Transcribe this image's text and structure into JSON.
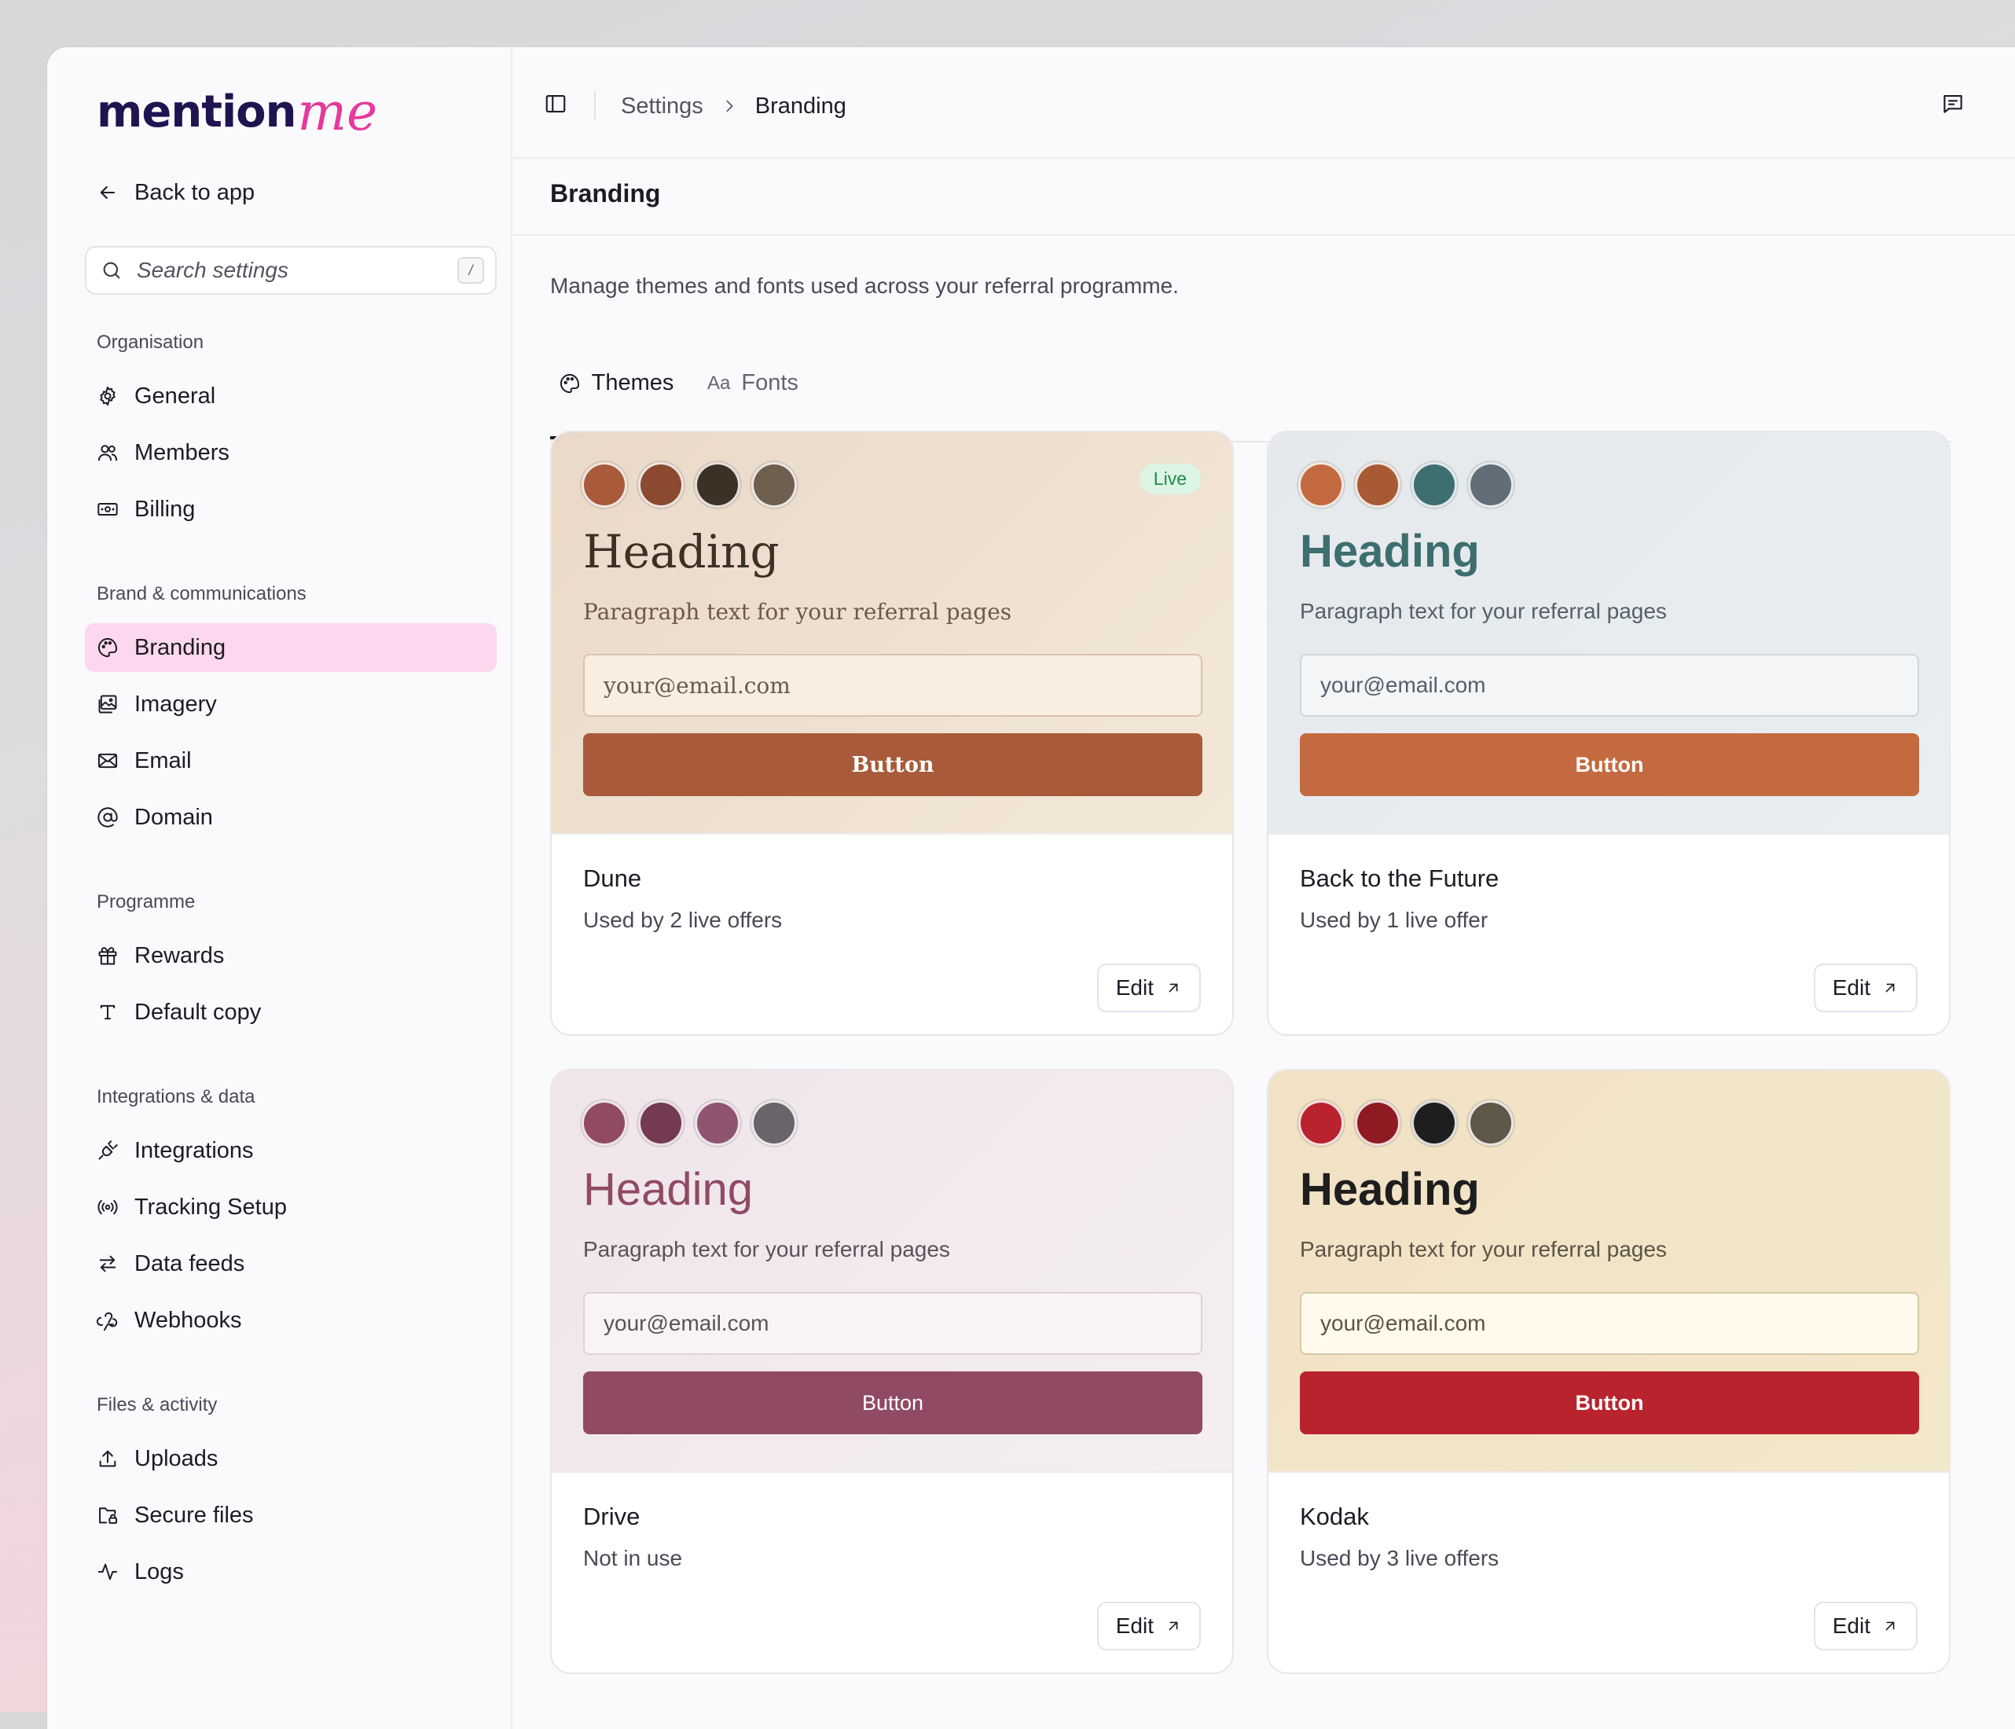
{
  "logo": {
    "main": "mention",
    "accent": "me"
  },
  "sidebar": {
    "back_label": "Back to app",
    "search": {
      "placeholder": "Search settings",
      "shortcut": "/"
    },
    "sections": [
      {
        "title": "Organisation",
        "items": [
          {
            "label": "General",
            "icon": "gear-icon"
          },
          {
            "label": "Members",
            "icon": "users-icon"
          },
          {
            "label": "Billing",
            "icon": "banknote-icon"
          }
        ]
      },
      {
        "title": "Brand & communications",
        "items": [
          {
            "label": "Branding",
            "icon": "palette-icon",
            "active": true
          },
          {
            "label": "Imagery",
            "icon": "images-icon"
          },
          {
            "label": "Email",
            "icon": "mail-icon"
          },
          {
            "label": "Domain",
            "icon": "at-sign-icon"
          }
        ]
      },
      {
        "title": "Programme",
        "items": [
          {
            "label": "Rewards",
            "icon": "gift-icon"
          },
          {
            "label": "Default copy",
            "icon": "type-icon"
          }
        ]
      },
      {
        "title": "Integrations & data",
        "items": [
          {
            "label": "Integrations",
            "icon": "plug-icon"
          },
          {
            "label": "Tracking Setup",
            "icon": "radio-icon"
          },
          {
            "label": "Data feeds",
            "icon": "arrows-left-right-icon"
          },
          {
            "label": "Webhooks",
            "icon": "webhook-icon"
          }
        ]
      },
      {
        "title": "Files & activity",
        "items": [
          {
            "label": "Uploads",
            "icon": "upload-icon"
          },
          {
            "label": "Secure files",
            "icon": "folder-lock-icon"
          },
          {
            "label": "Logs",
            "icon": "activity-icon"
          }
        ]
      }
    ]
  },
  "breadcrumb": {
    "parent": "Settings",
    "current": "Branding"
  },
  "page": {
    "title": "Branding",
    "description": "Manage themes and fonts used across your referral programme.",
    "tabs": [
      {
        "label": "Themes",
        "icon": "palette-icon",
        "active": true
      },
      {
        "label": "Fonts",
        "icon": "font-icon",
        "active": false
      }
    ]
  },
  "themes": [
    {
      "name": "Dune",
      "usage": "Used by 2 live offers",
      "live_badge": "Live",
      "swatches": [
        "#a85a3a",
        "#8c4a30",
        "#3d3126",
        "#6f5f4e"
      ],
      "heading": "Heading",
      "paragraph": "Paragraph text for your referral pages",
      "input_placeholder": "your@email.com",
      "button_label": "Button",
      "edit_label": "Edit",
      "colors": {
        "bg_from": "#ead9c9",
        "bg_to": "#f3e8d8",
        "heading": "#3d3126",
        "paragraph": "#6b5a4a",
        "input_bg": "#f8eee1",
        "input_border": "#d9c4ad",
        "input_text": "#6b5a4a",
        "button_bg": "#a85a3a"
      }
    },
    {
      "name": "Back to the Future",
      "usage": "Used by 1 live offer",
      "live_badge": "",
      "swatches": [
        "#c46a40",
        "#a85a35",
        "#3d6e70",
        "#616d77"
      ],
      "heading": "Heading",
      "paragraph": "Paragraph text for your referral pages",
      "input_placeholder": "your@email.com",
      "button_label": "Button",
      "edit_label": "Edit",
      "colors": {
        "bg_from": "#e5e9ec",
        "bg_to": "#e9eef0",
        "heading": "#3d6e70",
        "paragraph": "#55606a",
        "input_bg": "#f3f5f7",
        "input_border": "#cfd6dc",
        "input_text": "#55606a",
        "button_bg": "#c46a40"
      }
    },
    {
      "name": "Drive",
      "usage": "Not in use",
      "live_badge": "",
      "swatches": [
        "#914a63",
        "#733a52",
        "#8f5570",
        "#6a636a"
      ],
      "heading": "Heading",
      "paragraph": "Paragraph text for your referral pages",
      "input_placeholder": "your@email.com",
      "button_label": "Button",
      "edit_label": "Edit",
      "colors": {
        "bg_from": "#efe5ea",
        "bg_to": "#f4eef1",
        "heading": "#914a63",
        "paragraph": "#5a5258",
        "input_bg": "#f8f4f6",
        "input_border": "#ddd2d8",
        "input_text": "#5a5258",
        "button_bg": "#914a63"
      }
    },
    {
      "name": "Kodak",
      "usage": "Used by 3 live offers",
      "live_badge": "",
      "swatches": [
        "#b8232e",
        "#8f1a22",
        "#1e1e1e",
        "#5f5748"
      ],
      "heading": "Heading",
      "paragraph": "Paragraph text for your referral pages",
      "input_placeholder": "your@email.com",
      "button_label": "Button",
      "edit_label": "Edit",
      "colors": {
        "bg_from": "#f1e1c5",
        "bg_to": "#f3e8c9",
        "heading": "#1e1e1e",
        "paragraph": "#5a5346",
        "input_bg": "#fffaeb",
        "input_border": "#d8c9a6",
        "input_text": "#5a5346",
        "button_bg": "#b8232e"
      }
    }
  ]
}
